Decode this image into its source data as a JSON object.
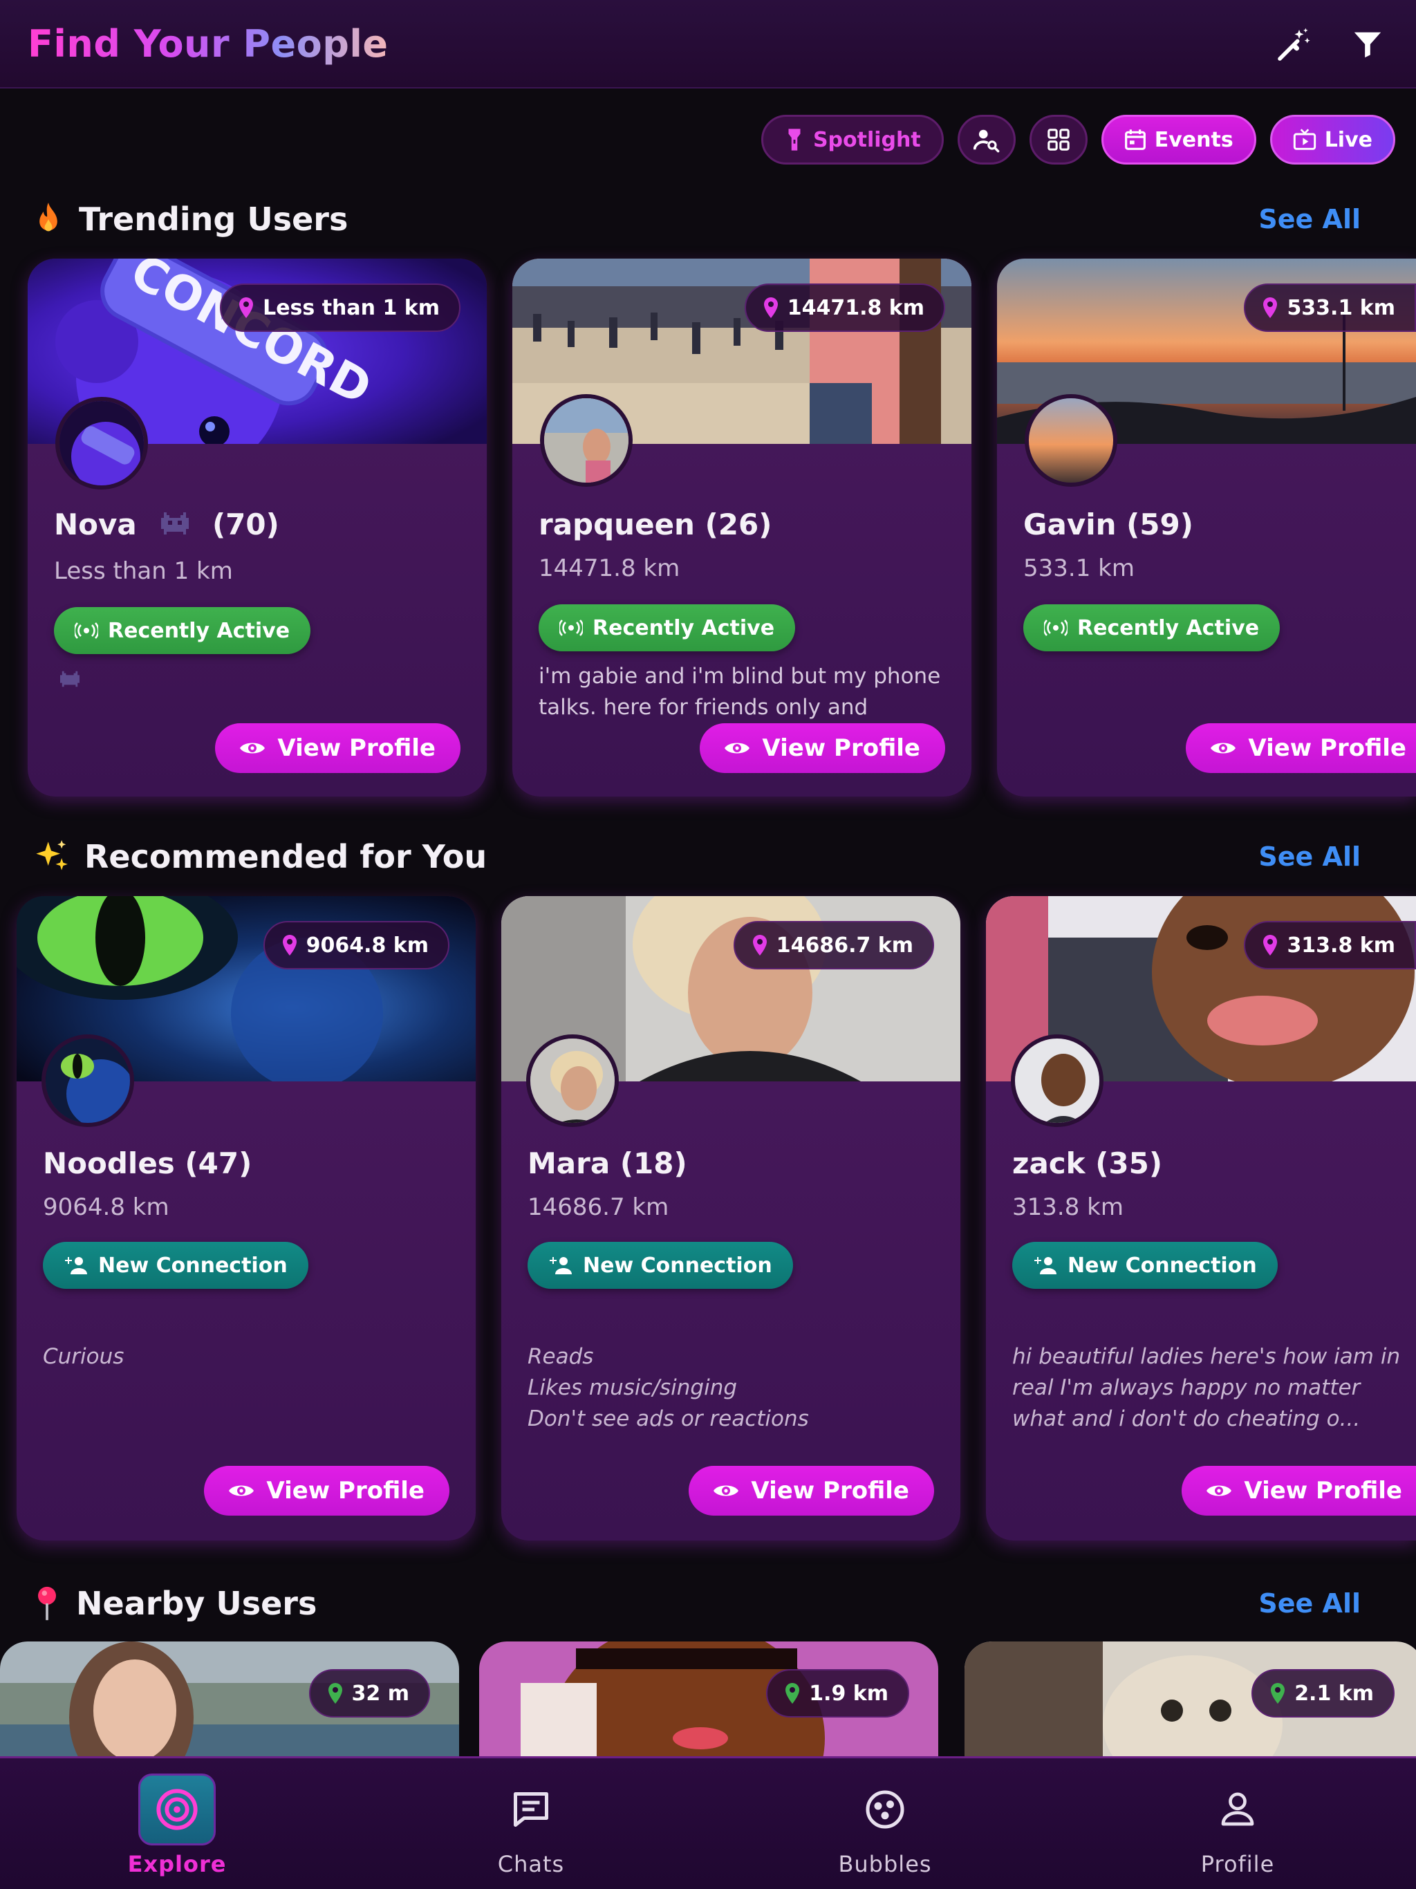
{
  "header": {
    "title": "Find Your People",
    "icons": [
      "magic-wand-icon",
      "filter-icon"
    ]
  },
  "chips": {
    "spotlight": "Spotlight",
    "events": "Events",
    "live": "Live"
  },
  "sections": {
    "trending": {
      "title": "Trending Users",
      "see_all": "See All",
      "icon": "fire-icon"
    },
    "recommended": {
      "title": "Recommended for You",
      "see_all": "See All",
      "icon": "sparkles-icon"
    },
    "nearby": {
      "title": "Nearby Users",
      "see_all": "See All",
      "icon": "pin-icon"
    }
  },
  "trending_users": [
    {
      "name": "Nova",
      "age": "(70)",
      "distance_badge": "Less than 1 km",
      "distance": "Less than 1 km",
      "status": "Recently Active",
      "bio": "",
      "view": "View Profile"
    },
    {
      "name": "rapqueen (26)",
      "distance_badge": "14471.8 km",
      "distance": "14471.8 km",
      "status": "Recently Active",
      "bio": "i'm gabie and i'm blind but my phone talks. here for friends only and absol...",
      "view": "View Profile"
    },
    {
      "name": "Gavin (59)",
      "distance_badge": "533.1 km",
      "distance": "533.1 km",
      "status": "Recently Active",
      "bio": "",
      "view": "View Profile"
    }
  ],
  "recommended_users": [
    {
      "name": "Noodles (47)",
      "distance_badge": "9064.8 km",
      "distance": "9064.8 km",
      "status": "New Connection",
      "bio": "Curious",
      "view": "View Profile"
    },
    {
      "name": "Mara (18)",
      "distance_badge": "14686.7 km",
      "distance": "14686.7 km",
      "status": "New Connection",
      "bio": "Reads\nLikes music/singing\nDon't see ads or reactions",
      "view": "View Profile"
    },
    {
      "name": "zack (35)",
      "distance_badge": "313.8 km",
      "distance": "313.8 km",
      "status": "New Connection",
      "bio": "hi beautiful ladies here's how iam in real I'm always happy no matter what and i don't do cheating o...",
      "view": "View Profile"
    }
  ],
  "nearby_users": [
    {
      "distance_badge": "32 m"
    },
    {
      "distance_badge": "1.9 km"
    },
    {
      "distance_badge": "2.1 km"
    }
  ],
  "nav": {
    "explore": "Explore",
    "chats": "Chats",
    "bubbles": "Bubbles",
    "profile": "Profile",
    "active": "Explore"
  },
  "colors": {
    "accent": "#e01ee6",
    "link": "#3f8ef6",
    "active_green": "#3fb14e",
    "connection_teal": "#128a86"
  }
}
